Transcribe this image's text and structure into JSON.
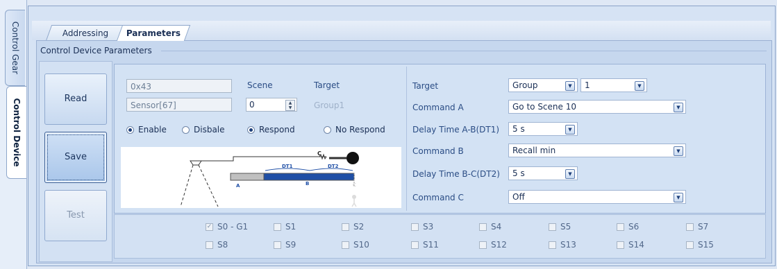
{
  "side_tabs": [
    {
      "label": "Control Gear",
      "active": false
    },
    {
      "label": "Control Device",
      "active": true
    }
  ],
  "tabs": [
    {
      "label": "Addressing",
      "active": false
    },
    {
      "label": "Parameters",
      "active": true
    }
  ],
  "group_title": "Control Device Parameters",
  "buttons": {
    "read": "Read",
    "save": "Save",
    "test": "Test"
  },
  "device": {
    "address": "0x43",
    "name": "Sensor[67]",
    "enable_label": "Enable",
    "disable_label": "Disbale",
    "enable_selected": true
  },
  "scene": {
    "label": "Scene",
    "value": "0",
    "target_label": "Target",
    "target_value": "Group1",
    "respond_label": "Respond",
    "no_respond_label": "No Respond",
    "respond_selected": true
  },
  "diagram": {
    "label_a": "A",
    "label_b": "B",
    "label_c": "C",
    "label_dt1": "DT1",
    "label_dt2": "DT2"
  },
  "right": {
    "target_label": "Target",
    "target_type": "Group",
    "target_number": "1",
    "command_a_label": "Command A",
    "command_a": "Go to Scene 10",
    "delay_ab_label": "Delay Time A-B(DT1)",
    "delay_ab": "5 s",
    "command_b_label": "Command B",
    "command_b": "Recall min",
    "delay_bc_label": "Delay Time B-C(DT2)",
    "delay_bc": "5 s",
    "command_c_label": "Command C",
    "command_c": "Off"
  },
  "scenes": [
    {
      "label": "S0 - G1",
      "checked": true
    },
    {
      "label": "S1",
      "checked": false
    },
    {
      "label": "S2",
      "checked": false
    },
    {
      "label": "S3",
      "checked": false
    },
    {
      "label": "S4",
      "checked": false
    },
    {
      "label": "S5",
      "checked": false
    },
    {
      "label": "S6",
      "checked": false
    },
    {
      "label": "S7",
      "checked": false
    },
    {
      "label": "S8",
      "checked": false
    },
    {
      "label": "S9",
      "checked": false
    },
    {
      "label": "S10",
      "checked": false
    },
    {
      "label": "S11",
      "checked": false
    },
    {
      "label": "S12",
      "checked": false
    },
    {
      "label": "S13",
      "checked": false
    },
    {
      "label": "S14",
      "checked": false
    },
    {
      "label": "S15",
      "checked": false
    }
  ],
  "colors": {
    "accent": "#1d3f7a",
    "bar_fill": "#1f4fa6",
    "panel": "#d3e2f4"
  }
}
